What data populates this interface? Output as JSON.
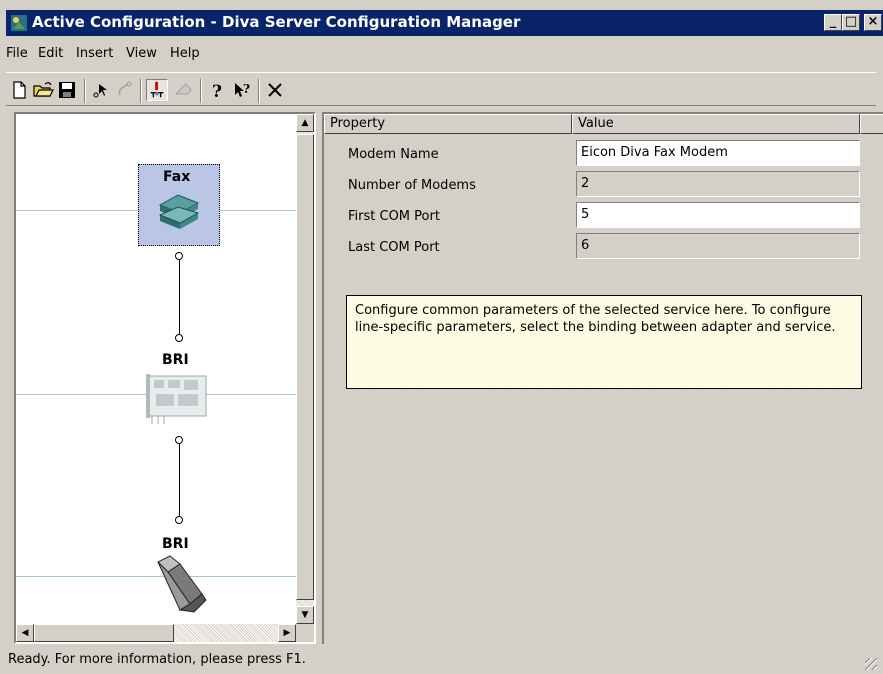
{
  "window": {
    "title": "Active Configuration - Diva Server Configuration Manager",
    "controls": {
      "minimize": "_",
      "maximize": "□",
      "close": "×"
    }
  },
  "menu": [
    {
      "label": "File"
    },
    {
      "label": "Edit"
    },
    {
      "label": "Insert"
    },
    {
      "label": "View"
    },
    {
      "label": "Help"
    }
  ],
  "toolbar": {
    "icons": [
      "new-document-icon",
      "open-folder-icon",
      "save-disk-icon",
      "pointer-tool-icon",
      "link-tool-icon",
      "bind-tool-icon",
      "disabled-tool-icon",
      "help-icon",
      "context-help-icon",
      "delete-icon"
    ]
  },
  "tree": {
    "nodes": [
      {
        "label": "Fax",
        "icon": "fax-modem-icon"
      },
      {
        "label": "BRI",
        "icon": "isdn-card-icon"
      },
      {
        "label": "BRI",
        "icon": "network-plug-icon"
      }
    ]
  },
  "grid": {
    "columns": [
      "Property",
      "Value"
    ],
    "rows": [
      {
        "label": "Modem Name",
        "value": "Eicon Diva Fax Modem",
        "editable": true
      },
      {
        "label": "Number of Modems",
        "value": "2",
        "editable": false
      },
      {
        "label": "First COM Port",
        "value": "5",
        "editable": true
      },
      {
        "label": "Last COM Port",
        "value": "6",
        "editable": false
      }
    ]
  },
  "info_text": "Configure common parameters of the selected service here. To configure line-specific parameters, select the binding between adapter and service.",
  "status": "Ready. For more information, please press F1.",
  "colors": {
    "title_bar": "#0a246a",
    "face": "#d4d0c8",
    "info_background": "#ffffe1"
  }
}
